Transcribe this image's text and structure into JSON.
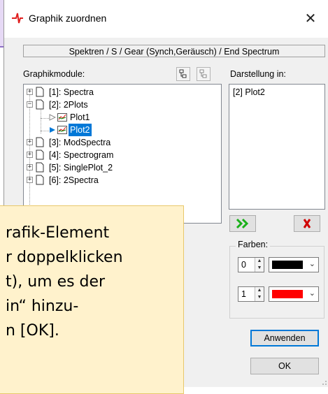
{
  "dialog": {
    "title": "Graphik zuordnen",
    "close_label": "✕"
  },
  "path": "Spektren / S / Gear (Synch,Geräusch) / End Spectrum",
  "modules_label": "Graphikmodule:",
  "display_label": "Darstellung in:",
  "tree": [
    {
      "label": "[1]: Spectra",
      "expander": "+"
    },
    {
      "label": "[2]: 2Plots",
      "expander": "−"
    },
    {
      "label": "Plot1"
    },
    {
      "label": "Plot2",
      "selected": true
    },
    {
      "label": "[3]: ModSpectra",
      "expander": "+"
    },
    {
      "label": "[4]: Spectrogram",
      "expander": "+"
    },
    {
      "label": "[5]: SinglePlot_2",
      "expander": "+"
    },
    {
      "label": "[6]: 2Spectra",
      "expander": "+"
    }
  ],
  "display_list": [
    "[2] Plot2"
  ],
  "buttons": {
    "add_icon": "double-chevron-right-icon",
    "remove_icon": "red-x-icon"
  },
  "colors": {
    "label": "Farben:",
    "rows": [
      {
        "index": "0",
        "color": "#000000"
      },
      {
        "index": "1",
        "color": "#ff0000"
      }
    ]
  },
  "apply_label": "Anwenden",
  "ok_label": "OK",
  "callout_lines": [
    "rafik-Element",
    "r doppelklicken",
    "t), um es der",
    " in“ hinzu-",
    "n [OK]."
  ]
}
